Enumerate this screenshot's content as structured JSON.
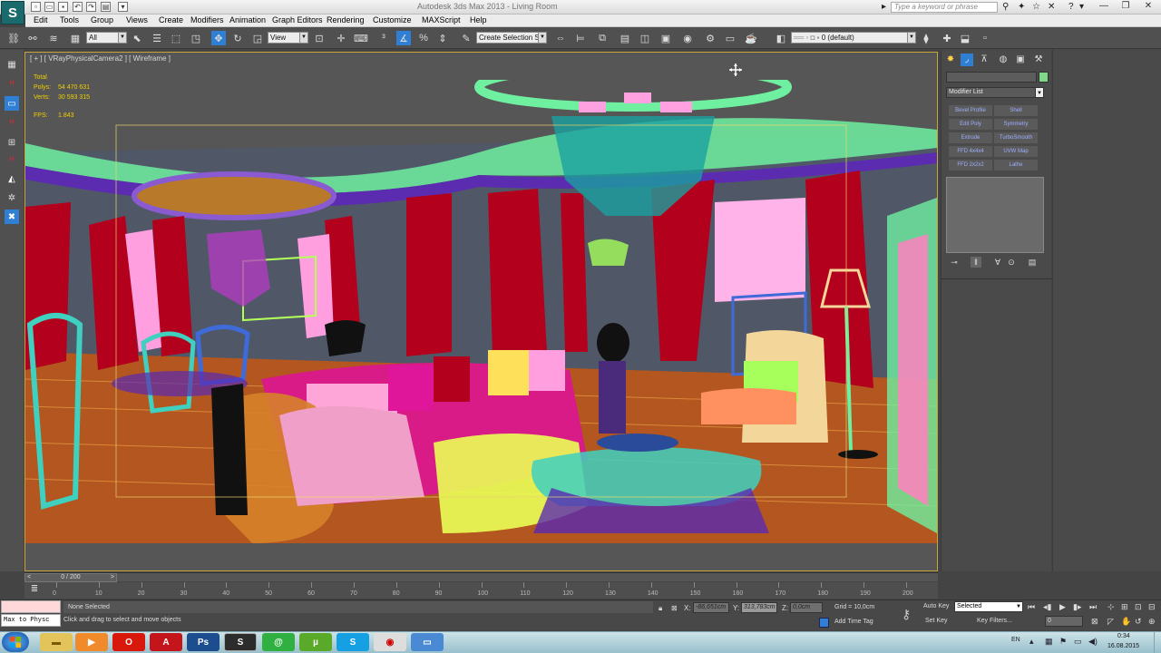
{
  "app": {
    "title": "Autodesk 3ds Max 2013 - Living Room",
    "logo_letter": "S",
    "search_placeholder": "Type a keyword or phrase"
  },
  "menu": [
    "Edit",
    "Tools",
    "Group",
    "Views",
    "Create",
    "Modifiers",
    "Animation",
    "Graph Editors",
    "Rendering",
    "Customize",
    "MAXScript",
    "Help"
  ],
  "toolbar": {
    "selection_filter": "All",
    "reference_coord": "View",
    "named_selection": "Create Selection Se",
    "layer": "0 (default)"
  },
  "viewport": {
    "label": "[ + ] [ VRayPhysicalCamera2 ] [ Wireframe ]",
    "stats": {
      "total_label": "Total",
      "polys_label": "Polys:",
      "polys_value": "54 470 631",
      "verts_label": "Verts:",
      "verts_value": "30 593 315",
      "fps_label": "FPS:",
      "fps_value": "1.843"
    }
  },
  "command_panel": {
    "modifier_list": "Modifier List",
    "modifier_buttons": [
      "Bevel Profile",
      "Shell",
      "Edit Poly",
      "Symmetry",
      "Extrude",
      "TurboSmooth",
      "FFD 4x4x4",
      "UVW Map",
      "FFD 2x2x2",
      "Lathe"
    ]
  },
  "timeline": {
    "slider": "0 / 200",
    "ticks": [
      "0",
      "10",
      "20",
      "30",
      "40",
      "50",
      "60",
      "70",
      "80",
      "90",
      "100",
      "110",
      "120",
      "130",
      "140",
      "150",
      "160",
      "170",
      "180",
      "190",
      "200"
    ]
  },
  "status": {
    "maxscript": "Max to Physc",
    "selection": "None Selected",
    "prompt": "Click and drag to select and move objects",
    "x_label": "X:",
    "x_value": "-86,651cm",
    "y_label": "Y:",
    "y_value": "313,783cm",
    "z_label": "Z:",
    "z_value": "0,0cm",
    "grid": "Grid = 10,0cm",
    "add_time_tag": "Add Time Tag",
    "auto_key": "Auto Key",
    "set_key": "Set Key",
    "selected_mode": "Selected",
    "key_filters": "Key Filters...",
    "frame": "0"
  },
  "taskbar": {
    "apps": [
      "Explorer",
      "Media Player",
      "Opera",
      "Acrobat",
      "Photoshop",
      "3ds Max",
      "Chat",
      "uTorrent",
      "Skype",
      "Recorder",
      "Desktop"
    ],
    "lang": "EN",
    "time": "0:34",
    "date": "16.08.2015"
  },
  "colors": {
    "accent": "#2f7fd4",
    "viewport_border": "#c9a43b",
    "stats_text": "#f0d000",
    "wire_red": "#b3001c",
    "wire_green": "#6ff0a0",
    "wire_pink": "#ff80c0"
  }
}
